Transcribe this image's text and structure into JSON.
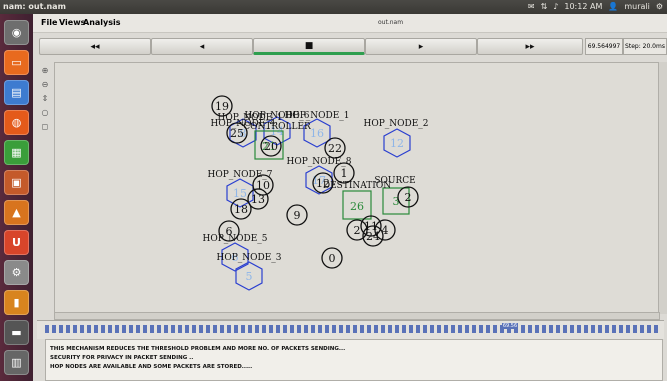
{
  "system_bar": {
    "title": "nam: out.nam",
    "time": "10:12 AM",
    "user": "murali"
  },
  "menu": {
    "file": "File",
    "views": "Views",
    "analysis": "Analysis",
    "window_title": "out.nam"
  },
  "controls": {
    "rewind": "◂◂",
    "back": "◂",
    "stop": "■",
    "play": "▸",
    "fast_forward": "▸▸",
    "time_value": "69.564997",
    "step_label": "Step: 20.0ms"
  },
  "labels": [
    "HOP_NODE_1",
    "HOP_NODE_2",
    "HOP_NODE_3",
    "HOP_NODE_4",
    "HOP_NODE_5",
    "HOP_NODE_6",
    "HOP_NODE_7",
    "HOP_NODE_8",
    "CONTROLLER",
    "DESTINATION",
    "SOURCE"
  ],
  "nodes_plain": [
    "0",
    "1",
    "2",
    "3",
    "4",
    "7",
    "9",
    "10",
    "11",
    "13",
    "18",
    "19",
    "20",
    "22",
    "23",
    "24",
    "25"
  ],
  "nodes_hex": [
    "5",
    "6",
    "8",
    "12",
    "14",
    "15",
    "16",
    "17"
  ],
  "nodes_square": [
    "21",
    "26",
    "3"
  ],
  "console": {
    "line1": "THIS MECHANISM REDUCES THE THRESHOLD PROBLEM AND MORE NO. OF PACKETS SENDING...",
    "line2": "SECURITY FOR PRIVACY IN PACKET SENDING ..",
    "line3": "HOP NODES ARE AVAILABLE AND SOME PACKETS ARE STORED....."
  },
  "timeline_marker": "69.56"
}
